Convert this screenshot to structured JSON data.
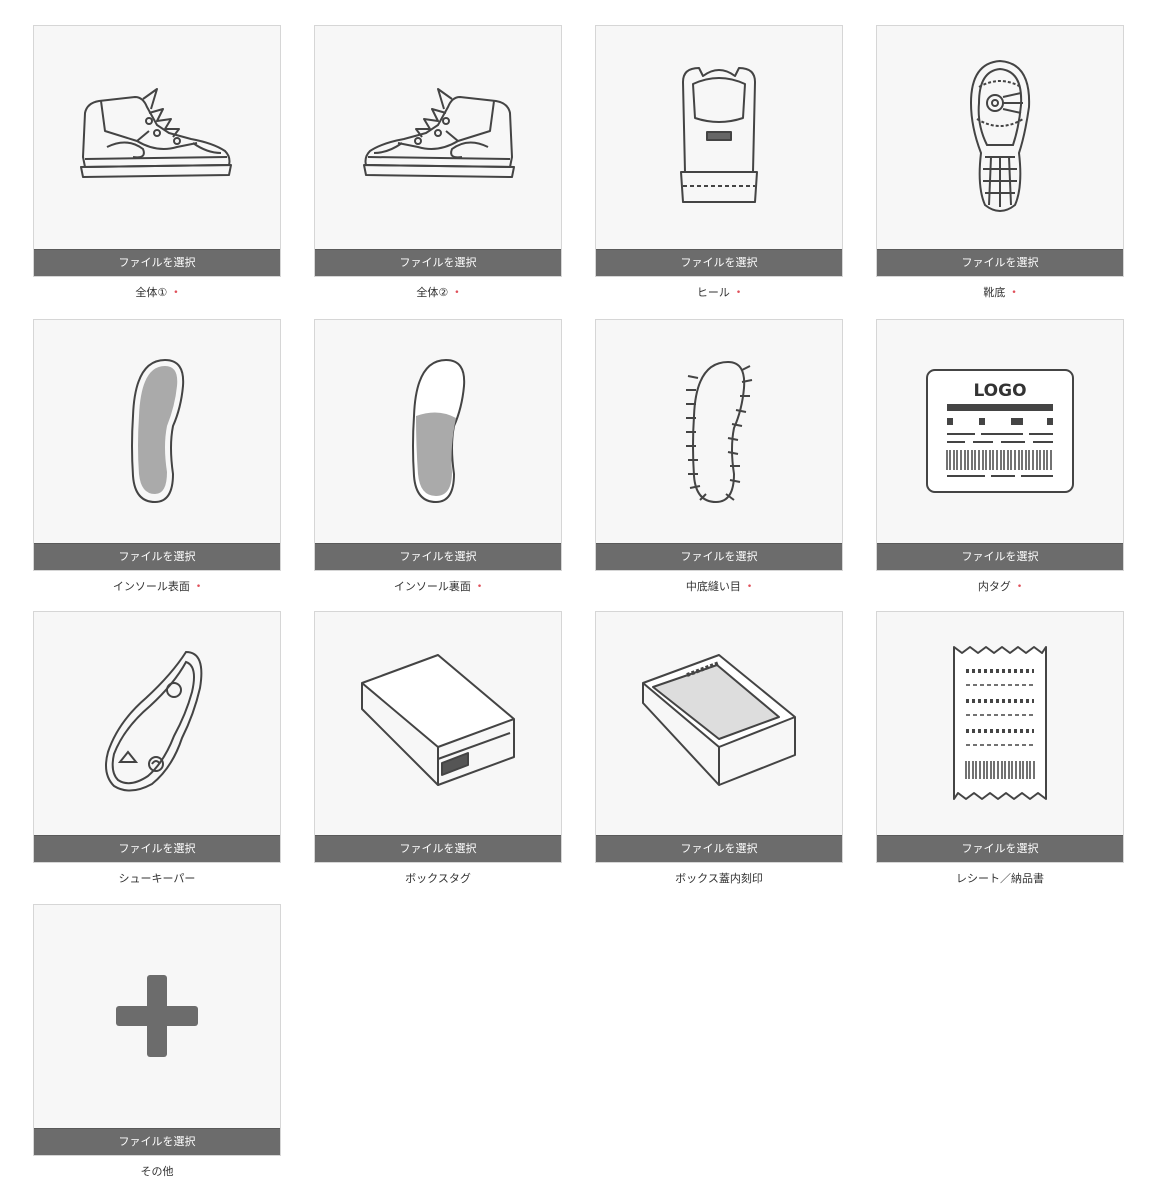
{
  "upload_button_label": "ファイルを選択",
  "required_mark": "•",
  "tiles": [
    {
      "label": "全体①",
      "required": true,
      "icon": "sneaker-side-left-icon"
    },
    {
      "label": "全体②",
      "required": true,
      "icon": "sneaker-side-right-icon"
    },
    {
      "label": "ヒール",
      "required": true,
      "icon": "sneaker-heel-icon"
    },
    {
      "label": "靴底",
      "required": true,
      "icon": "outsole-icon"
    },
    {
      "label": "インソール表面",
      "required": true,
      "icon": "insole-top-icon"
    },
    {
      "label": "インソール裏面",
      "required": true,
      "icon": "insole-bottom-icon"
    },
    {
      "label": "中底縫い目",
      "required": true,
      "icon": "midsole-stitch-icon"
    },
    {
      "label": "内タグ",
      "required": true,
      "icon": "inner-tag-icon",
      "tag_text": "LOGO"
    },
    {
      "label": "シューキーパー",
      "required": false,
      "icon": "shoe-keeper-icon"
    },
    {
      "label": "ボックスタグ",
      "required": false,
      "icon": "box-tag-icon"
    },
    {
      "label": "ボックス蓋内刻印",
      "required": false,
      "icon": "box-lid-stamp-icon"
    },
    {
      "label": "レシート／納品書",
      "required": false,
      "icon": "receipt-icon"
    },
    {
      "label": "その他",
      "required": false,
      "icon": "plus-icon"
    }
  ]
}
